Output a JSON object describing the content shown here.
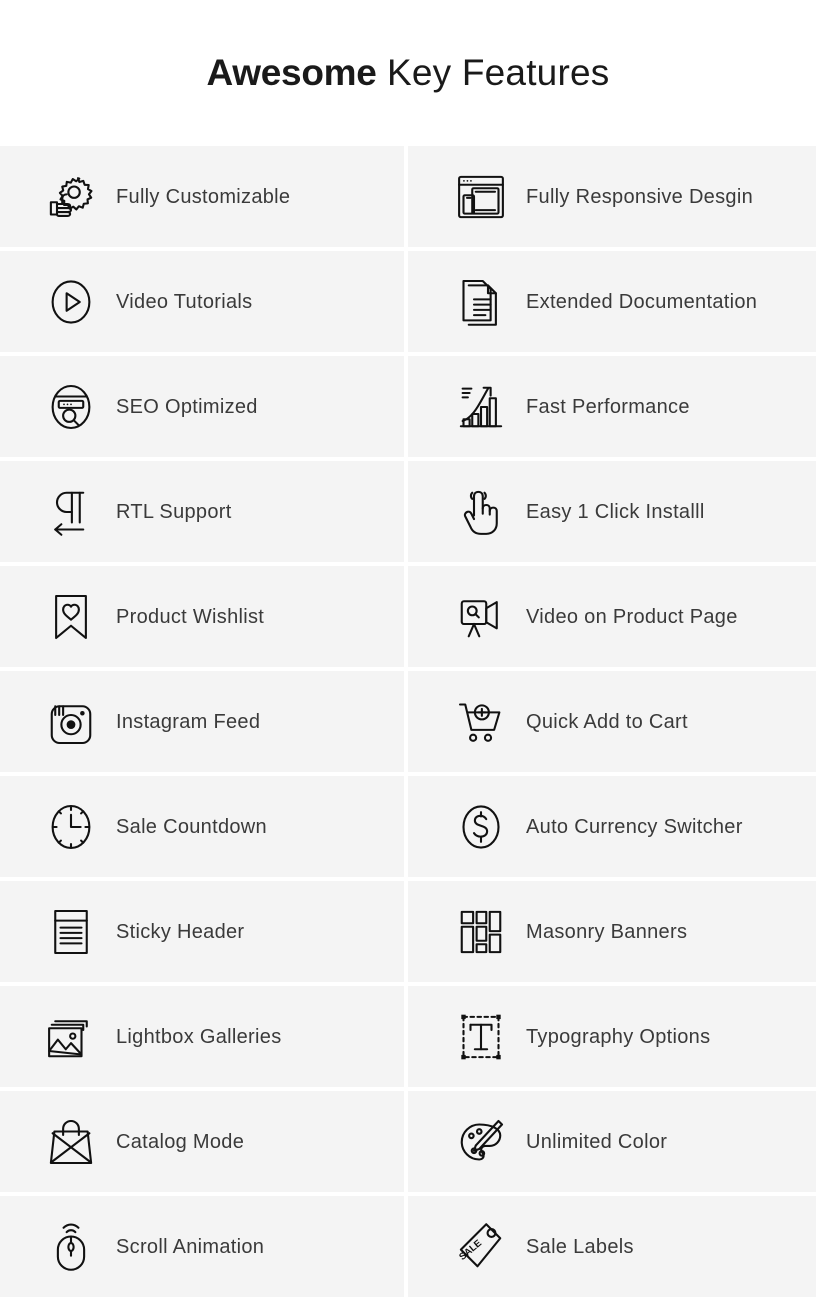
{
  "page": {
    "background": "#ffffff",
    "cell_background": "#f4f4f4",
    "text_color": "#3a3a3a",
    "icon_color": "#111111",
    "title_color": "#1a1a1a"
  },
  "header": {
    "title_strong": "Awesome",
    "title_light": " Key Features"
  },
  "features": [
    {
      "label": "Fully Customizable",
      "icon": "gear-hand-icon",
      "column": "left"
    },
    {
      "label": "Fully Responsive Desgin",
      "icon": "responsive-devices-icon",
      "column": "right"
    },
    {
      "label": "Video Tutorials",
      "icon": "play-circle-icon",
      "column": "left"
    },
    {
      "label": "Extended Documentation",
      "icon": "documents-icon",
      "column": "right"
    },
    {
      "label": "SEO Optimized",
      "icon": "seo-search-icon",
      "column": "left"
    },
    {
      "label": "Fast Performance",
      "icon": "bar-chart-arrow-icon",
      "column": "right"
    },
    {
      "label": "RTL Support",
      "icon": "pilcrow-arrow-icon",
      "column": "left"
    },
    {
      "label": "Easy 1 Click Installl",
      "icon": "click-hand-icon",
      "column": "right"
    },
    {
      "label": "Product Wishlist",
      "icon": "bookmark-heart-icon",
      "column": "left"
    },
    {
      "label": "Video on Product Page",
      "icon": "video-camera-icon",
      "column": "right"
    },
    {
      "label": "Instagram Feed",
      "icon": "instagram-camera-icon",
      "column": "left"
    },
    {
      "label": "Quick Add to Cart",
      "icon": "cart-plus-icon",
      "column": "right"
    },
    {
      "label": "Sale Countdown",
      "icon": "clock-icon",
      "column": "left"
    },
    {
      "label": "Auto Currency Switcher",
      "icon": "dollar-circle-icon",
      "column": "right"
    },
    {
      "label": "Sticky Header",
      "icon": "sticky-header-icon",
      "column": "left"
    },
    {
      "label": "Masonry Banners",
      "icon": "masonry-grid-icon",
      "column": "right"
    },
    {
      "label": "Lightbox Galleries",
      "icon": "image-stack-icon",
      "column": "left"
    },
    {
      "label": "Typography Options",
      "icon": "typography-t-icon",
      "column": "right"
    },
    {
      "label": "Catalog Mode",
      "icon": "no-bag-icon",
      "column": "left"
    },
    {
      "label": "Unlimited Color",
      "icon": "palette-brush-icon",
      "column": "right"
    },
    {
      "label": "Scroll Animation",
      "icon": "mouse-signal-icon",
      "column": "left"
    },
    {
      "label": "Sale Labels",
      "icon": "sale-tag-icon",
      "column": "right"
    }
  ]
}
